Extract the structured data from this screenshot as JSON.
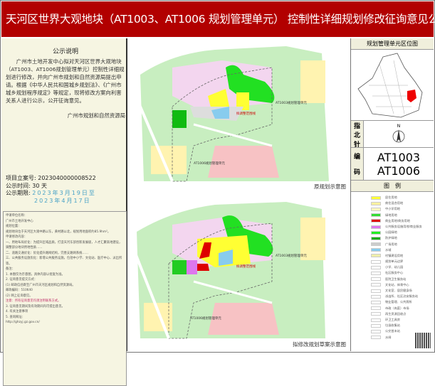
{
  "title": "天河区世界大观地块（AT1003、AT1006 规划管理单元） 控制性详细规划修改征询意见公示",
  "notice": {
    "heading": "公示说明",
    "body": "广州市土地开发中心拟对天河区世界大观地块（AT1003、AT1006规划管理单元）控制性详细规划进行修改，并向广州市规划和自然资源局提出申请。根据《中华人民共和国城乡规划法》、《广州市城乡规划程序规定》等规定，现将修改方案向利害关系人进行公示，公开征询意见。",
    "signature": "广州市规划和自然资源局"
  },
  "meta": {
    "project_no_label": "项目立案号:",
    "project_no": "2023040000008522",
    "duration_label": "公示时间:",
    "duration": "30 天",
    "period_label": "公示期限:",
    "period_start": "2023年3月19日至",
    "period_end": "2023年4月17日"
  },
  "detail": {
    "lines": [
      "申请单位名称：",
      "广州市土地开发中心",
      "规划位置：",
      "规划地块位于天河区大观中路以东，黄村路以北，规划用地面积约85.9hm²。",
      "申请修改内容：",
      "一、用地布局优化：为提升区域品质，打造天河东部创新发展极，人才汇聚高地建设，调整部分地块用地性质……",
      "二、道路交通优化：优化提升路网结构，完善支路网系统……",
      "三、公共服务设施优化：新增公共服务设施，包括中小学、文化站、医疗中心、派出所等。",
      "备注：",
      "1. 本图仅为示意图，具体内容以批复为准。",
      "2. 征询意见提交方式：",
      "(1) 邮政信函寄至广州市天河区规划和自然资源局。",
      "邮政编码：510640",
      "(2) 网上征询意见。",
      "注意：所有征询意见均须注明联系方式。",
      "3. 征询意见期间及有效期间内可提出意见。",
      "4. 有关注意事项",
      "5. 查询网址：",
      "http://ghzyj.gz.gov.cn/"
    ]
  },
  "maps": {
    "original_caption": "原规划示意图",
    "draft_caption": "拟修改规划草案示意图",
    "labels": {
      "unit_a": "AT1003规划管理单元",
      "unit_b": "AT1006规划管理单元",
      "scope": "拟调整范围线"
    }
  },
  "right": {
    "location_header": "规划管理单元区位图",
    "compass_label": [
      "指",
      "北",
      "针"
    ],
    "compass_n": "N",
    "code_label": [
      "编",
      "码"
    ],
    "codes": [
      "AT1003",
      "AT1006"
    ],
    "legend_header": "图　例",
    "legend": [
      {
        "label": "居住用地",
        "color": "#ffff33"
      },
      {
        "label": "商住混合用地",
        "color": "#fff2a0"
      },
      {
        "label": "中小学用地",
        "color": "#fff8c0"
      },
      {
        "label": "绿地用地",
        "color": "#33dd33"
      },
      {
        "label": "商业用地/商务用地",
        "color": "#dd0000"
      },
      {
        "label": "公共服务设施用地/商业服务",
        "color": "#dd77ee"
      },
      {
        "label": "公园绿地",
        "color": "#22ee22"
      },
      {
        "label": "防护绿地",
        "color": "#11aa11"
      },
      {
        "label": "广场用地",
        "color": "#cccccc"
      },
      {
        "label": "水域",
        "color": "#88ccee"
      },
      {
        "label": "村镇建设用地",
        "color": "#eeeeaa"
      },
      {
        "label": "规划单元边界",
        "color": "#ffffff"
      },
      {
        "label": "小学、幼儿园",
        "color": "#ffffff"
      },
      {
        "label": "社区服务中心",
        "color": "#ffffff"
      },
      {
        "label": "医院卫生服务站",
        "color": "#ffffff"
      },
      {
        "label": "文化站、体育中心",
        "color": "#ffffff"
      },
      {
        "label": "文化室、居民健身场",
        "color": "#ffffff"
      },
      {
        "label": "派出所、社区治安服务站",
        "color": "#ffffff"
      },
      {
        "label": "物业管理、公共厕所",
        "color": "#ffffff"
      },
      {
        "label": "市政（肉菜）市场",
        "color": "#ffffff"
      },
      {
        "label": "再生资源回收点",
        "color": "#ffffff"
      },
      {
        "label": "环卫工具房",
        "color": "#ffffff"
      },
      {
        "label": "垃圾收集站",
        "color": "#ffffff"
      },
      {
        "label": "公交首末站",
        "color": "#ffffff"
      },
      {
        "label": "水闸",
        "color": "#ffffff"
      }
    ],
    "accent": "#b20000"
  }
}
